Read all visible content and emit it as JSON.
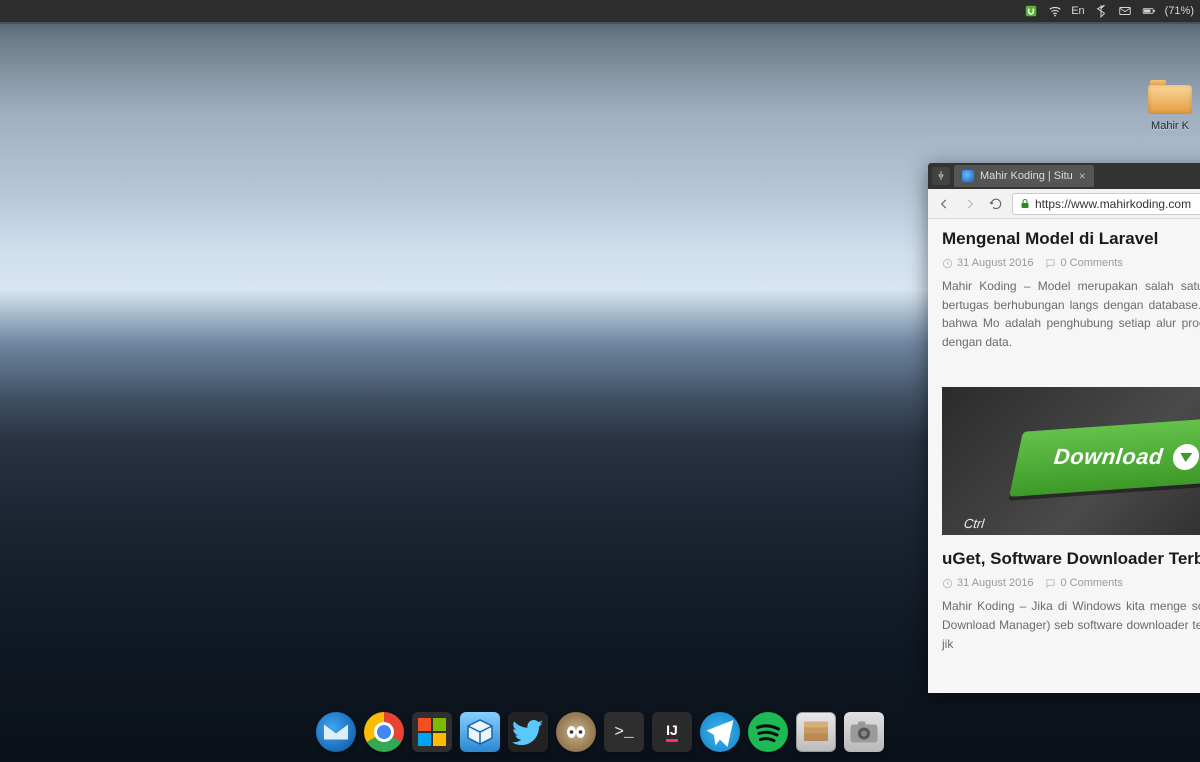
{
  "panel": {
    "lang": "En",
    "battery": "(71%)"
  },
  "desktop": {
    "folder_label": "Mahir K"
  },
  "browser": {
    "tab_title": "Mahir Koding | Situ",
    "url_display": "https://www.mahirkoding.com",
    "post1": {
      "title": "Mengenal Model di Laravel",
      "date": "31 August 2016",
      "comments": "0 Comments",
      "body": "Mahir Koding – Model merupakan salah satu bagian MVC yang bertugas berhubungan langs dengan database. Bisa dikatakan juga bahwa Mo adalah penghubung setiap alur program y berhubungan dengan data."
    },
    "post2": {
      "image_text": "Download",
      "image_ctrl": "Ctrl",
      "title": "uGet, Software Downloader Terbaik di Lin",
      "date": "31 August 2016",
      "comments": "0 Comments",
      "body": "Mahir Koding – Jika di Windows kita menge software IDM (Internet Download Manager) seb software downloader terbaik lalu bagaimana jik"
    }
  },
  "dock": {
    "items": [
      "thunderbird",
      "chrome",
      "winapps",
      "virtualbox",
      "twitter",
      "gimp",
      "terminal",
      "intellij",
      "telegram",
      "spotify",
      "files",
      "camera"
    ],
    "intellij_label": "IJ"
  }
}
